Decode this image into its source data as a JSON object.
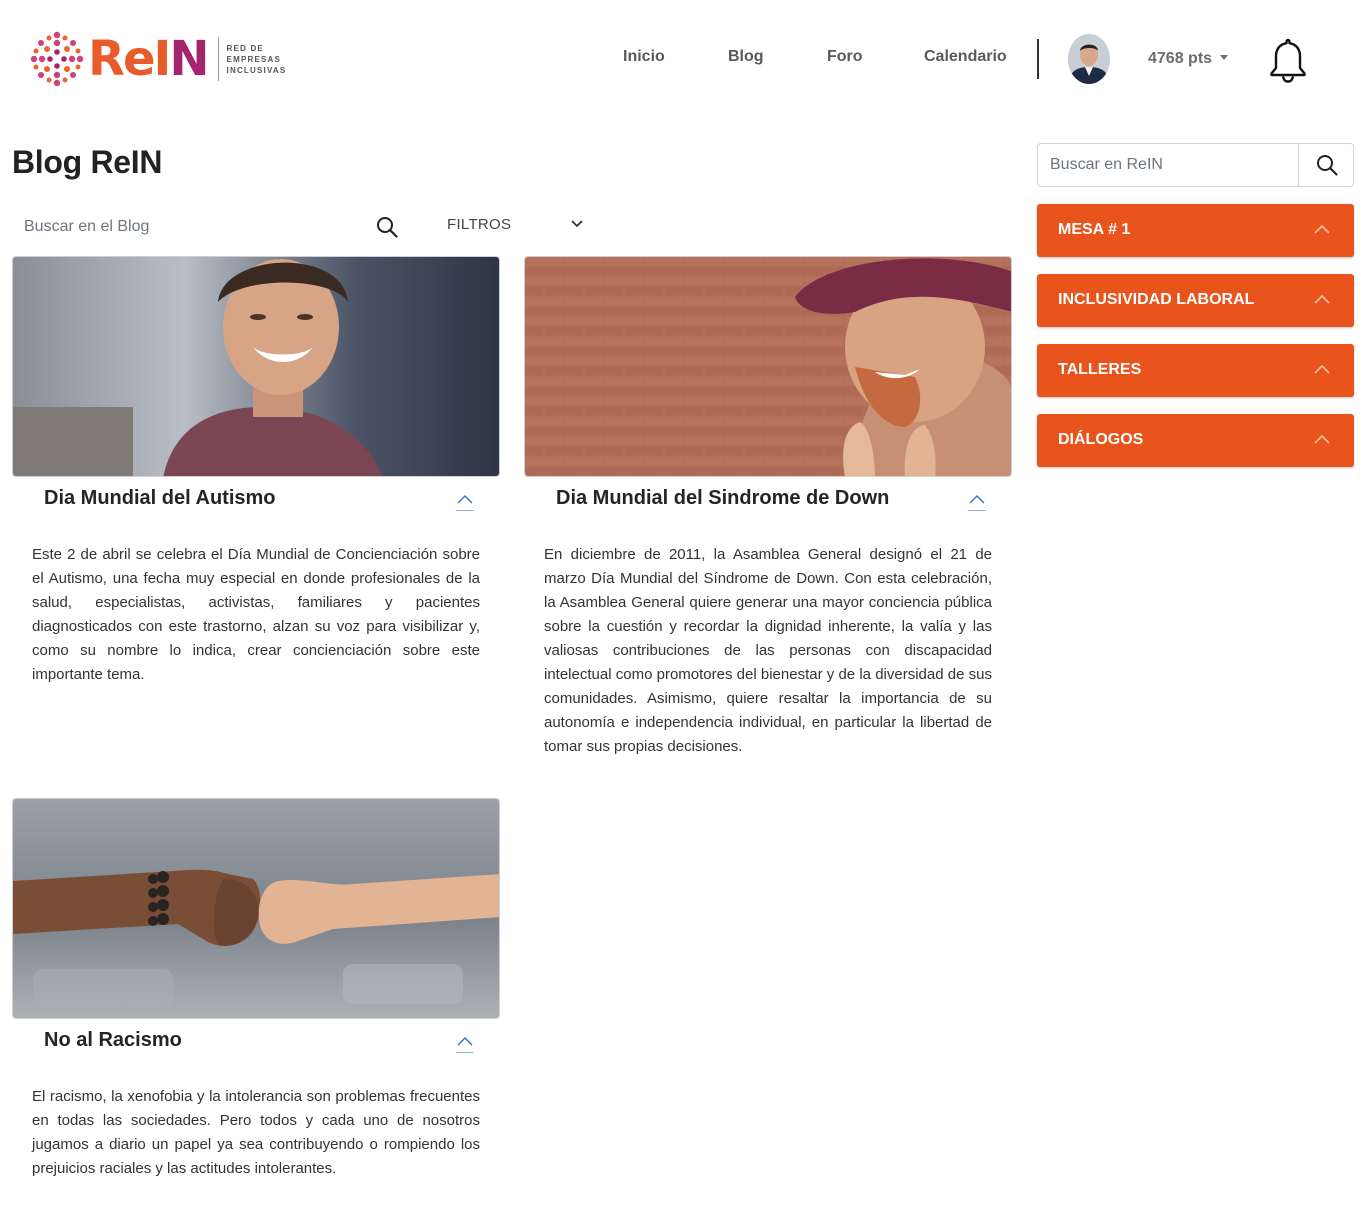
{
  "brand": {
    "name_part1": "ReI",
    "name_part2": "N",
    "tagline": [
      "RED DE",
      "EMPRESAS",
      "INCLUSIVAS"
    ],
    "colors": {
      "orange": "#e85c2c",
      "magenta": "#a4256e"
    }
  },
  "nav": {
    "items": [
      "Inicio",
      "Blog",
      "Foro",
      "Calendario"
    ]
  },
  "user": {
    "points_label": "4768 pts",
    "avatar_icon": "user-photo",
    "notification_icon": "bell-icon"
  },
  "page": {
    "title": "Blog ReIN",
    "search_placeholder": "Buscar en el Blog",
    "filters_label": "FILTROS"
  },
  "posts": [
    {
      "title": "Dia Mundial del Autismo",
      "image": "smiling-man-photo",
      "body": "Este 2 de abril se celebra el Día Mundial de Concienciación sobre el Autismo, una fecha muy especial en donde profesionales de la salud, especialistas, activistas, familiares y pacientes diagnosticados con este trastorno, alzan su voz para visibilizar y, como su nombre lo indica, crear concienciación sobre este importante tema."
    },
    {
      "title": "Dia Mundial del Sindrome de Down",
      "image": "laughing-man-cap-photo",
      "body": "En diciembre de 2011, la Asamblea General designó el 21 de marzo Día Mundial del Síndrome de Down. Con esta celebración, la Asamblea General quiere generar una mayor conciencia pública sobre la cuestión y recordar la dignidad inherente, la valía y las valiosas contribuciones de las personas con discapacidad intelectual como promotores del bienestar y de la diversidad de sus comunidades. Asimismo, quiere resaltar la importancia de su autonomía e independencia individual, en particular la libertad de tomar sus propias decisiones."
    },
    {
      "title": "No al Racismo",
      "image": "fist-bump-photo",
      "body": "El racismo, la xenofobia y la intolerancia son problemas frecuentes en todas las sociedades. Pero todos y cada uno de nosotros jugamos a diario un papel ya sea contribuyendo o rompiendo los prejuicios raciales y las actitudes intolerantes."
    }
  ],
  "sidebar": {
    "search_placeholder": "Buscar en ReIN",
    "accent_color": "#e8541c",
    "items": [
      "MESA # 1",
      "INCLUSIVIDAD LABORAL",
      "TALLERES",
      "DIÁLOGOS"
    ]
  }
}
